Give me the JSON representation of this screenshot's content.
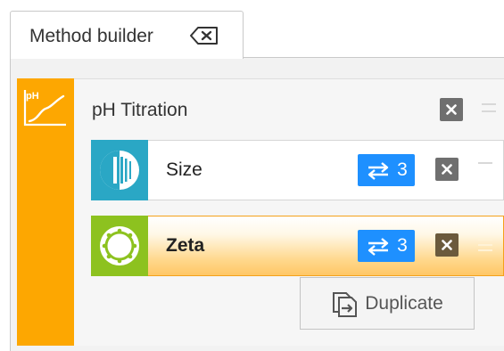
{
  "tab": {
    "label": "Method builder",
    "close_icon": "backspace-close-icon"
  },
  "group": {
    "title": "pH Titration",
    "icon": "ph-chart-icon",
    "accent_color": "#fda701",
    "remove_icon": "close-icon"
  },
  "rows": [
    {
      "label": "Size",
      "icon": "size-measurement-icon",
      "tile_color": "#2aa7c5",
      "repeat_count": "3",
      "repeat_icon": "repeat-icon",
      "selected": false
    },
    {
      "label": "Zeta",
      "icon": "zeta-measurement-icon",
      "tile_color": "#8dc21f",
      "repeat_count": "3",
      "repeat_icon": "repeat-icon",
      "selected": true
    }
  ],
  "duplicate_button": {
    "label": "Duplicate",
    "icon": "duplicate-icon"
  },
  "colors": {
    "badge_blue": "#1e90ff",
    "close_button_grey": "#6f6f6f",
    "selected_border": "#f4a11a"
  }
}
